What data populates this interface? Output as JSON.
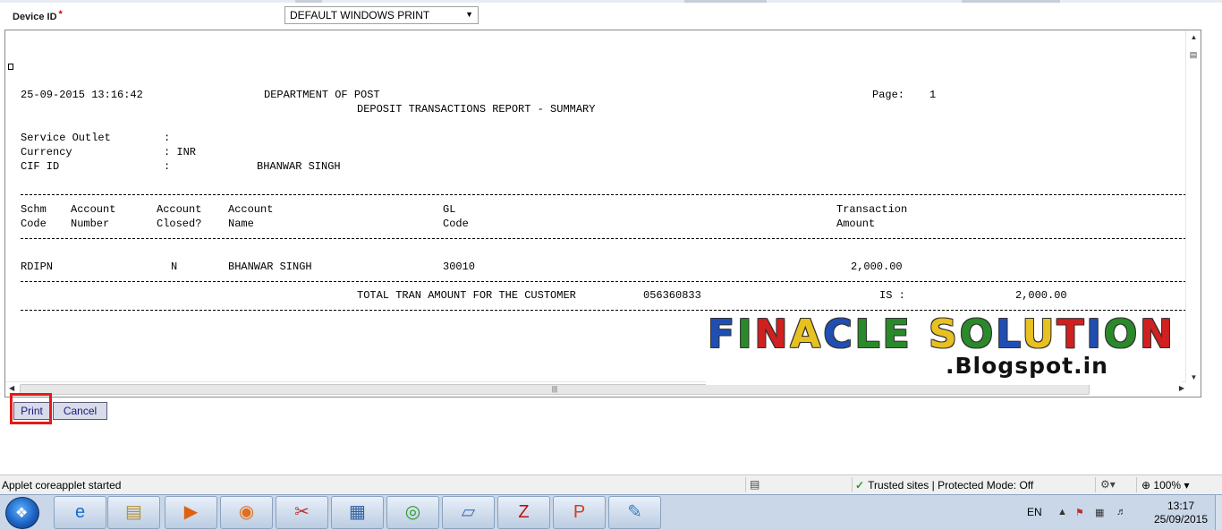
{
  "form": {
    "device_label": "Device ID",
    "required_mark": "*",
    "device_value": "DEFAULT WINDOWS PRINT"
  },
  "report": {
    "header": {
      "datetime": "25-09-2015 13:16:42",
      "department": "DEPARTMENT OF POST",
      "page_label": "Page:",
      "page_number": "1",
      "title": "DEPOSIT TRANSACTIONS REPORT - SUMMARY"
    },
    "meta": {
      "service_outlet_label": "Service Outlet",
      "service_outlet_colon": ":",
      "currency_label": "Currency",
      "currency_value": ": INR",
      "cif_label": "CIF ID",
      "cif_colon": ":",
      "cif_value": "BHANWAR SINGH"
    },
    "columns": {
      "schm": [
        "Schm",
        "Code"
      ],
      "account_number": [
        "Account",
        "Number"
      ],
      "account_closed": [
        "Account",
        "Closed?"
      ],
      "account_name": [
        "Account",
        "Name"
      ],
      "gl_code": [
        "GL",
        "Code"
      ],
      "tran_amount": [
        "Transaction",
        "Amount"
      ]
    },
    "row": {
      "schm_code": "RDIPN",
      "account_closed": "N",
      "account_name": "BHANWAR SINGH",
      "gl_code": "30010",
      "tran_amount": "2,000.00"
    },
    "total": {
      "label": "TOTAL TRAN AMOUNT FOR THE CUSTOMER",
      "cif": "056360833",
      "is_label": "IS :",
      "amount": "2,000.00"
    }
  },
  "watermark": {
    "letters": [
      {
        "ch": "F",
        "color": "#1f4fb4"
      },
      {
        "ch": "I",
        "color": "#2a8a2a"
      },
      {
        "ch": "N",
        "color": "#d02020"
      },
      {
        "ch": "A",
        "color": "#e8c020"
      },
      {
        "ch": "C",
        "color": "#1f4fb4"
      },
      {
        "ch": "L",
        "color": "#2a8a2a"
      },
      {
        "ch": "E",
        "color": "#2a8a2a"
      },
      {
        "ch": " ",
        "color": "#000000"
      },
      {
        "ch": "S",
        "color": "#e8c020"
      },
      {
        "ch": "O",
        "color": "#2a8a2a"
      },
      {
        "ch": "L",
        "color": "#1f4fb4"
      },
      {
        "ch": "U",
        "color": "#e8c020"
      },
      {
        "ch": "T",
        "color": "#d02020"
      },
      {
        "ch": "I",
        "color": "#1f4fb4"
      },
      {
        "ch": "O",
        "color": "#2a8a2a"
      },
      {
        "ch": "N",
        "color": "#d02020"
      }
    ],
    "sub": ".Blogspot.in"
  },
  "buttons": {
    "print": "Print",
    "cancel": "Cancel"
  },
  "statusbar": {
    "message": "Applet coreapplet started",
    "zone": "Trusted sites | Protected Mode: Off",
    "zoom": "100%"
  },
  "taskbar": {
    "lang": "EN",
    "time": "13:17",
    "date": "25/09/2015"
  }
}
